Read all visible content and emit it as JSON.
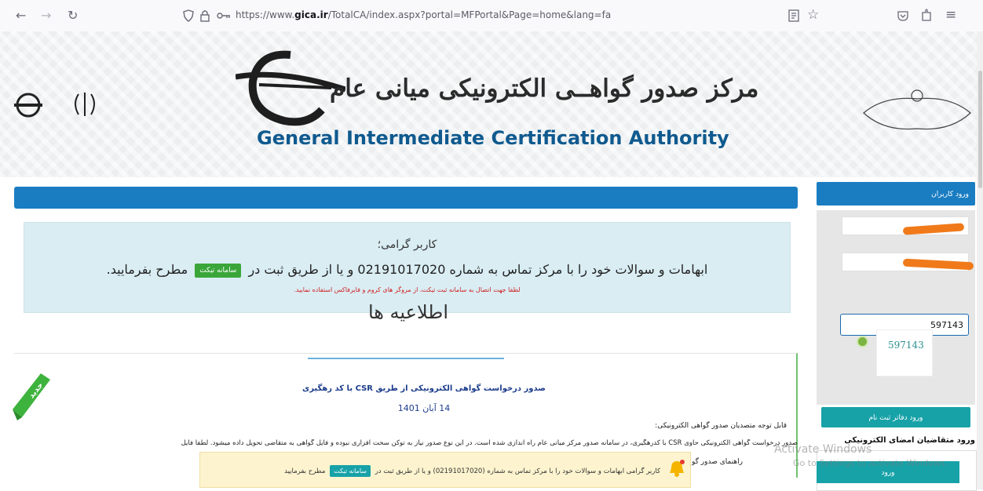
{
  "browser": {
    "url_prefix": "https://www.",
    "url_domain": "gica.ir",
    "url_rest": "/TotalCA/index.aspx?portal=MFPortal&Page=home&lang=fa",
    "icons": [
      "back-icon",
      "forward-icon",
      "reload-icon",
      "shield-icon",
      "lock-icon",
      "key-icon",
      "reader-icon",
      "star-icon",
      "pocket-icon",
      "extensions-icon",
      "menu-icon"
    ]
  },
  "header": {
    "title_fa": "مرکز صدور گواهــی الکترونیکی میانی عام",
    "title_en": "General Intermediate Certification Authority"
  },
  "info": {
    "greeting": "کاربر گرامی؛",
    "message_before": "ابهامات و سوالات خود را با مرکز تماس به شماره 02191017020 و یا از طریق ثبت در",
    "ticket_label": "سامانه تیکت",
    "message_after": "مطرح بفرمایید.",
    "warning": "لطفا جهت اتصال به سامانه ثبت تیکت، از مروگر های کروم و فایرفاکس استفاده نمایید."
  },
  "news": {
    "heading": "اطلاعیه ها",
    "badge": "جدید",
    "card_title": "صدور درخواست گواهی الکترونیکی از طریق CSR با کد رهگیری",
    "card_date": "14 آبان 1401",
    "p1": "قابل توجه متصدیان صدور گواهی الکترونیکی:",
    "p2": "صدور درخواست گواهی الکترونیکی حاوی CSR با کدرهگیری، در سامانه صدور مرکز میانی عام راه اندازی شده است. در این نوع صدور نیاز به توکن سخت افزاری نبوده و فایل گواهی به متقاضی تحویل داده میشود. لطفا فایل",
    "p3": "راهنمای صدور گو"
  },
  "sidebar": {
    "header": "ورود کاربران",
    "captcha_value": "597143",
    "captcha_image_text": "597143",
    "registry_button": "ورود دفاتر ثبت نام",
    "signers_label": "ورود متقاضیان امضای الکترونیکی",
    "login_button": "ورود"
  },
  "toast": {
    "text_before": "کاربر گرامی ابهامات و سوالات خود را با مرکز تماس به شماره (02191017020) و یا از طریق ثبت در",
    "ticket_label": "سامانه تیکت",
    "text_after": "مطرح بفرمایید"
  },
  "watermark": {
    "line1": "Activate Windows",
    "line2": "Go to Settings to activate Windows."
  },
  "colors": {
    "primary_blue": "#1a7dc2",
    "teal": "#17a2a8",
    "ticket_green": "#3aa63a",
    "info_bg": "#d9edf3",
    "toast_bg": "#fdf4cf"
  }
}
